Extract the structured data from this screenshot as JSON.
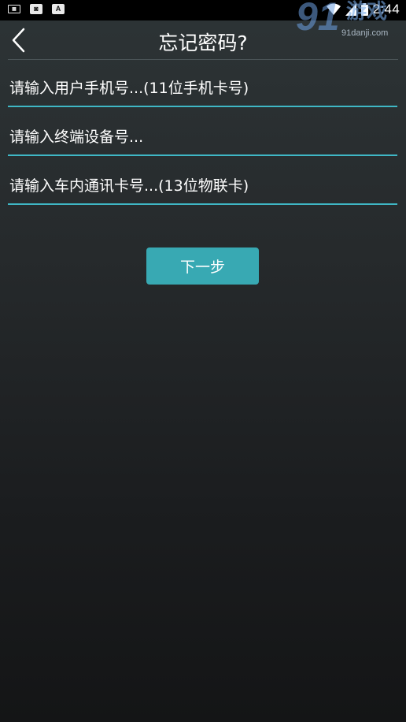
{
  "status_bar": {
    "time": "2:44",
    "icons": [
      "keyboard-icon",
      "notification-app-icon",
      "font-a-icon",
      "wifi-icon",
      "signal-icon",
      "battery-icon"
    ],
    "badge_letter": "A"
  },
  "watermark": {
    "number": "91",
    "label": "游戏",
    "url": "91danji.com"
  },
  "header": {
    "title": "忘记密码?",
    "back_icon": "chevron-left-icon"
  },
  "form": {
    "phone_placeholder": "请输入用户手机号...(11位手机卡号)",
    "phone_value": "",
    "terminal_placeholder": "请输入终端设备号...",
    "terminal_value": "",
    "card_placeholder": "请输入车内通讯卡号...(13位物联卡)",
    "card_value": "",
    "next_label": "下一步"
  },
  "colors": {
    "accent": "#3fb7c5",
    "button": "#38a9b3",
    "background_top": "#2d3436",
    "background_bottom": "#141516"
  }
}
